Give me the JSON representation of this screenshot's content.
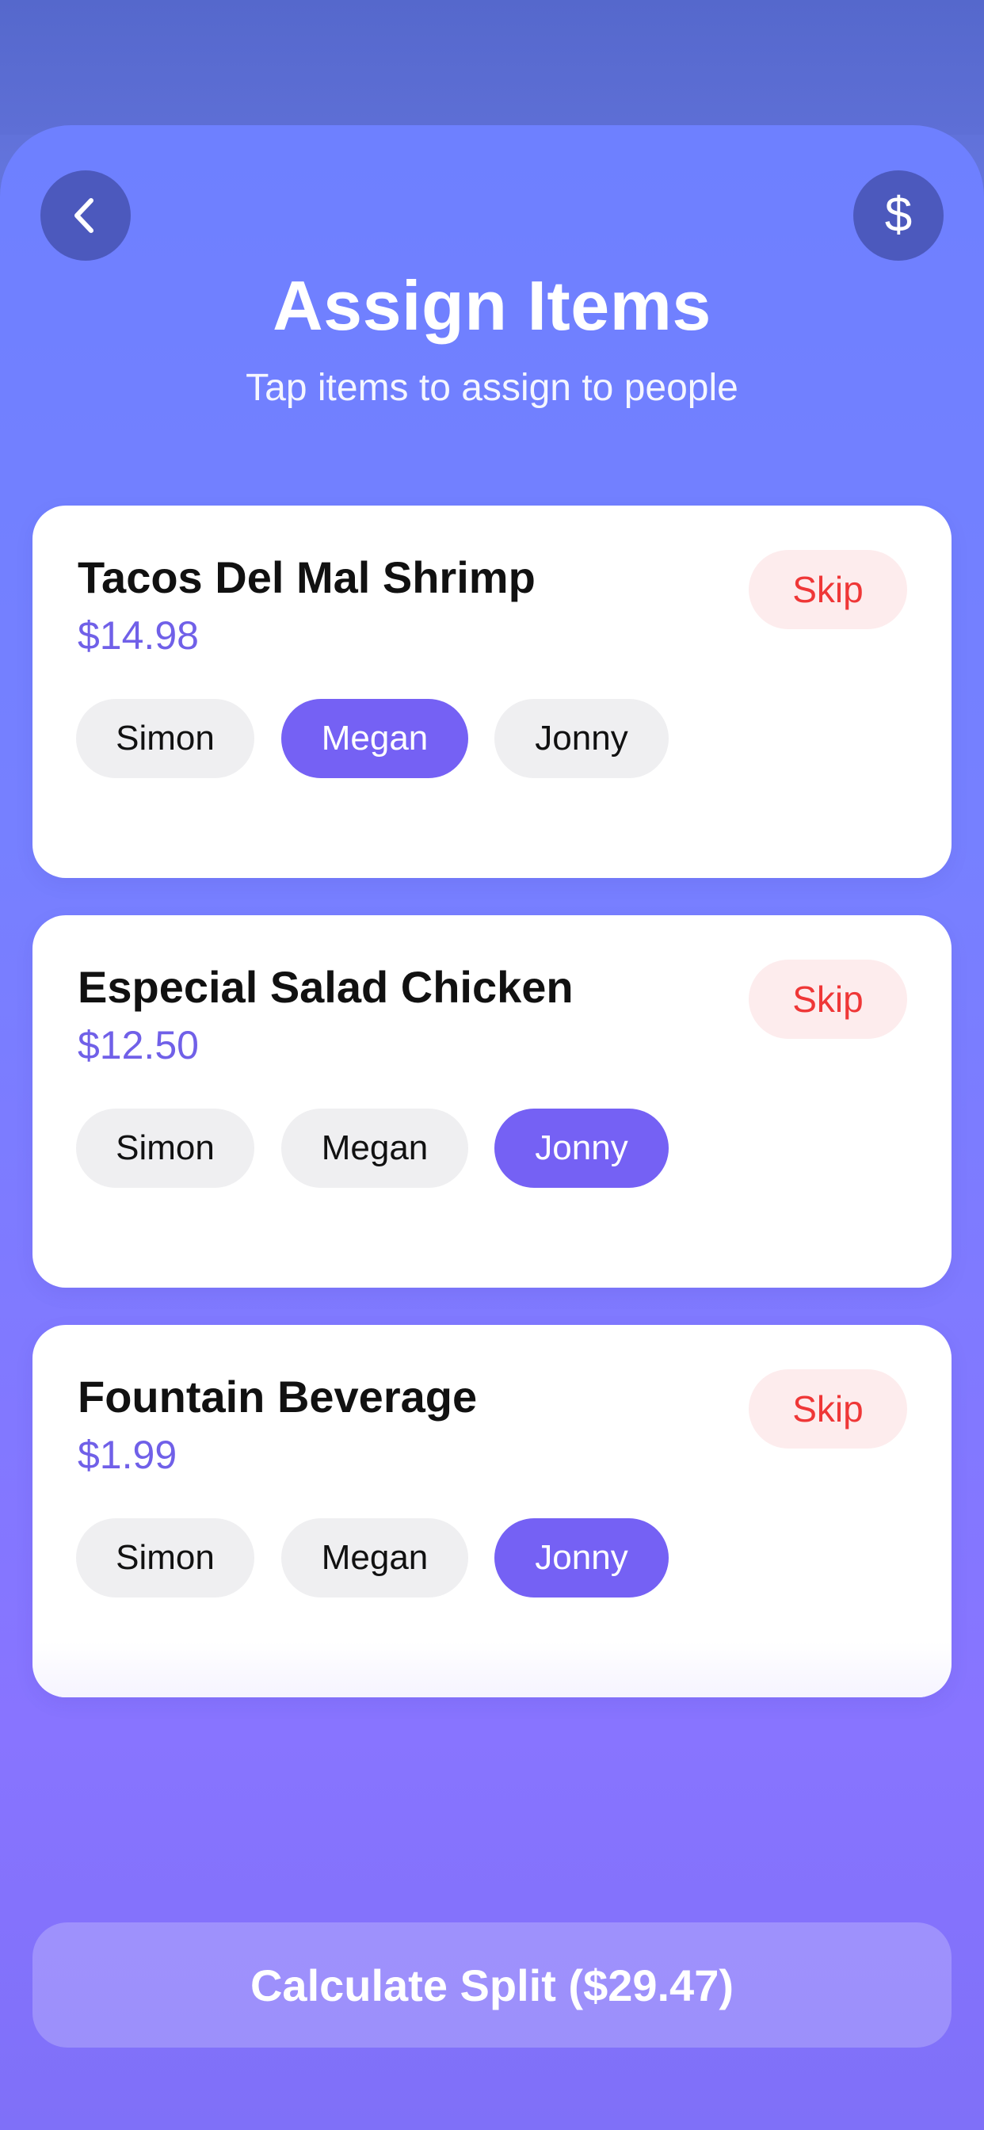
{
  "header": {
    "title": "Assign Items",
    "subtitle": "Tap items to assign to people",
    "back_icon": "chevron-left-icon",
    "currency_symbol": "$"
  },
  "items": [
    {
      "name": "Tacos Del Mal Shrimp",
      "price": "$14.98",
      "skip_label": "Skip",
      "people": [
        {
          "name": "Simon",
          "selected": false
        },
        {
          "name": "Megan",
          "selected": true
        },
        {
          "name": "Jonny",
          "selected": false
        }
      ]
    },
    {
      "name": "Especial Salad Chicken",
      "price": "$12.50",
      "skip_label": "Skip",
      "people": [
        {
          "name": "Simon",
          "selected": false
        },
        {
          "name": "Megan",
          "selected": false
        },
        {
          "name": "Jonny",
          "selected": true
        }
      ]
    },
    {
      "name": "Fountain Beverage",
      "price": "$1.99",
      "skip_label": "Skip",
      "people": [
        {
          "name": "Simon",
          "selected": false
        },
        {
          "name": "Megan",
          "selected": false
        },
        {
          "name": "Jonny",
          "selected": true
        }
      ]
    }
  ],
  "footer": {
    "calculate_label": "Calculate Split ($29.47)"
  },
  "colors": {
    "accent": "#7561f4",
    "skip_text": "#ef3737",
    "skip_bg": "#fdeced",
    "price": "#7060e8"
  }
}
